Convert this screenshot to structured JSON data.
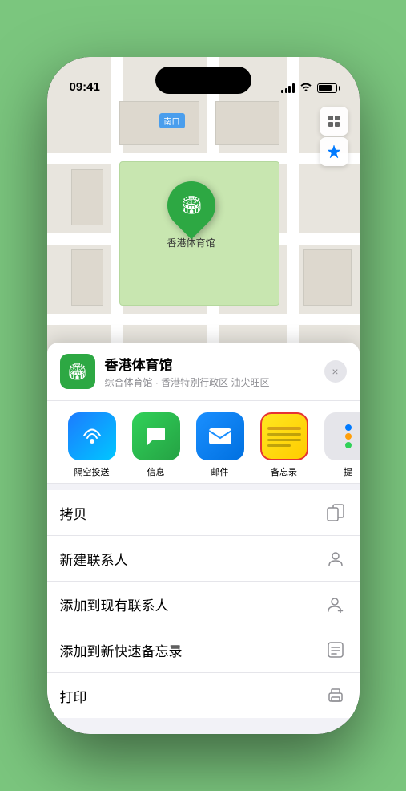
{
  "status_bar": {
    "time": "09:41",
    "location_arrow": "▶"
  },
  "map": {
    "label_tag": "南口",
    "location_name": "香港体育馆",
    "location_subtitle": "综合体育馆 · 香港特别行政区 油尖旺区"
  },
  "share_apps": [
    {
      "id": "airdrop",
      "label": "隔空投送",
      "type": "airdrop"
    },
    {
      "id": "messages",
      "label": "信息",
      "type": "messages"
    },
    {
      "id": "mail",
      "label": "邮件",
      "type": "mail"
    },
    {
      "id": "notes",
      "label": "备忘录",
      "type": "notes"
    },
    {
      "id": "more",
      "label": "提",
      "type": "more"
    }
  ],
  "actions": [
    {
      "id": "copy",
      "label": "拷贝",
      "icon": "copy"
    },
    {
      "id": "new-contact",
      "label": "新建联系人",
      "icon": "person"
    },
    {
      "id": "add-contact",
      "label": "添加到现有联系人",
      "icon": "person-add"
    },
    {
      "id": "add-notes",
      "label": "添加到新快速备忘录",
      "icon": "notes-quick"
    },
    {
      "id": "print",
      "label": "打印",
      "icon": "print"
    }
  ],
  "close_btn_label": "×",
  "home_indicator": ""
}
